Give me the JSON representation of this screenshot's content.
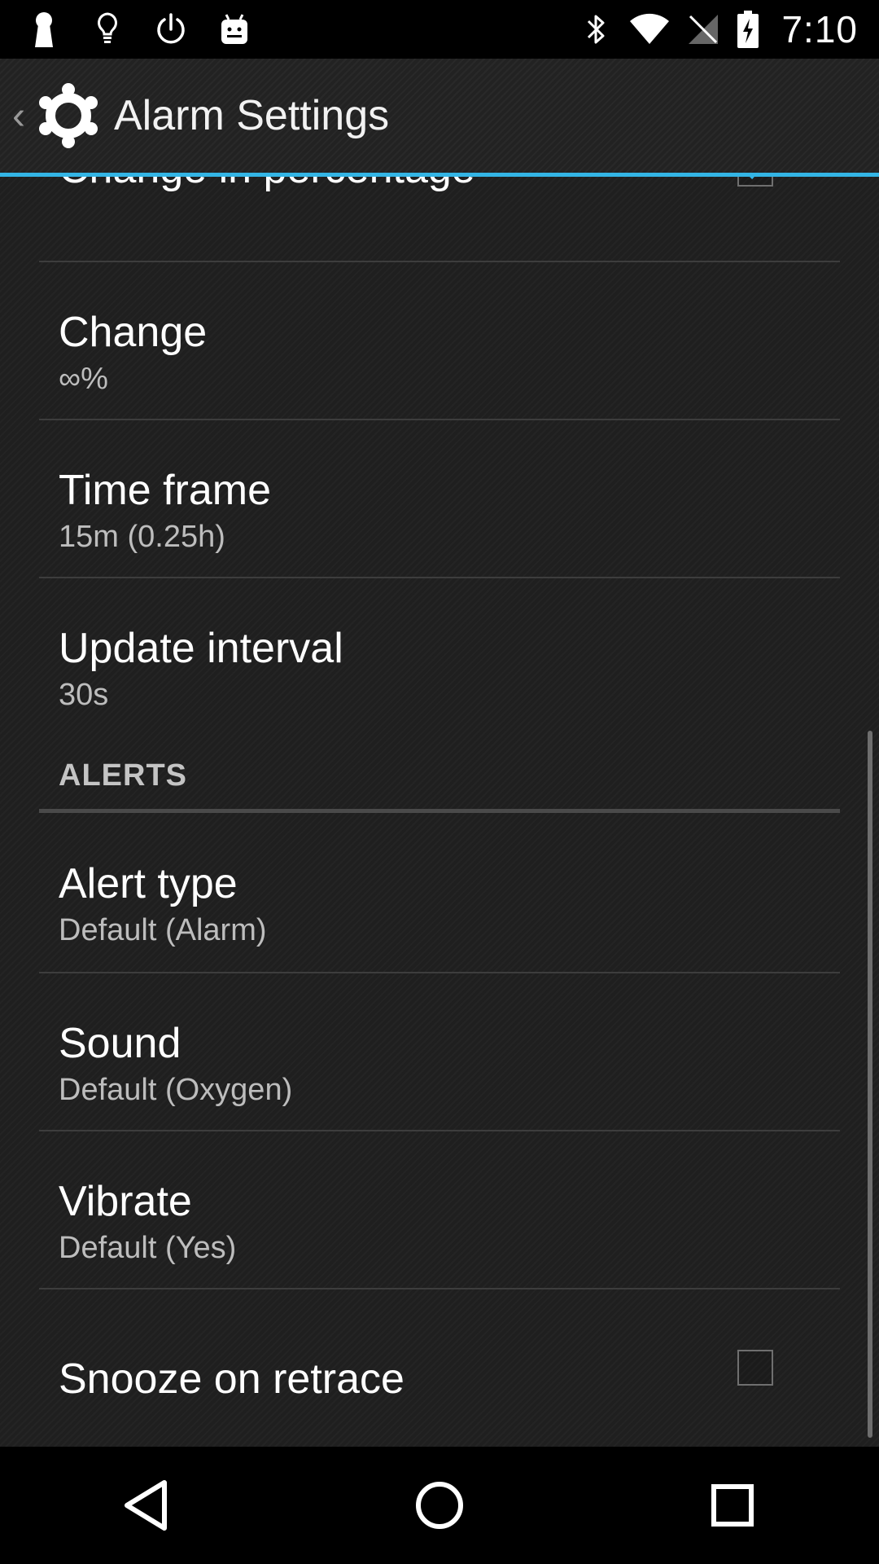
{
  "status_bar": {
    "time": "7:10",
    "left_icons": [
      "keyhole-icon",
      "lightbulb-icon",
      "power-icon",
      "android-icon"
    ],
    "right_icons": [
      "bluetooth-icon",
      "wifi-icon",
      "no-signal-icon",
      "battery-charging-icon"
    ]
  },
  "action_bar": {
    "title": "Alarm Settings",
    "icon": "gear-icon",
    "accent": "#33b5e5"
  },
  "preferences": {
    "change_in_percentage": {
      "title": "Change in percentage",
      "checked": true
    },
    "change": {
      "title": "Change",
      "summary": "∞%"
    },
    "time_frame": {
      "title": "Time frame",
      "summary": "15m (0.25h)"
    },
    "update_interval": {
      "title": "Update interval",
      "summary": "30s"
    },
    "alerts_header": "ALERTS",
    "alert_type": {
      "title": "Alert type",
      "summary": "Default (Alarm)"
    },
    "sound": {
      "title": "Sound",
      "summary": "Default (Oxygen)"
    },
    "vibrate": {
      "title": "Vibrate",
      "summary": "Default (Yes)"
    },
    "snooze_on_retrace": {
      "title": "Snooze on retrace",
      "checked": false
    }
  },
  "nav_bar": {
    "buttons": [
      "back-icon",
      "home-icon",
      "recents-icon"
    ]
  }
}
